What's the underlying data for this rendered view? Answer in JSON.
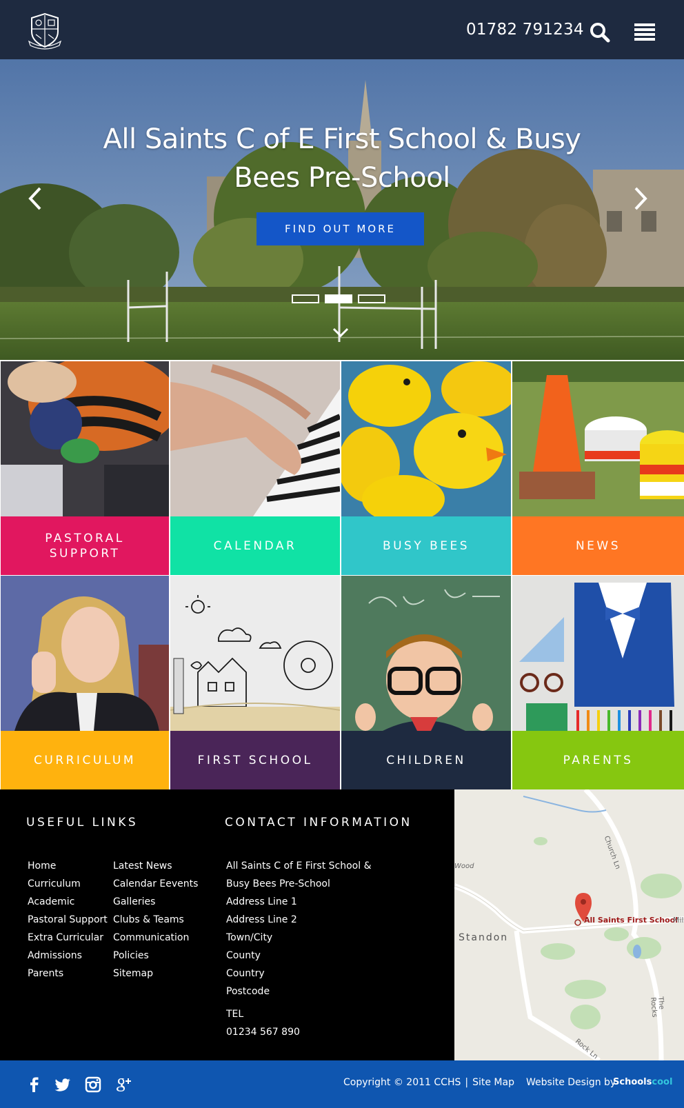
{
  "header": {
    "phone": "01782 791234",
    "logo_icon": "school-crest-icon",
    "search_icon": "search-icon",
    "menu_icon": "hamburger-menu-icon"
  },
  "hero": {
    "title": "All Saints C of E First School & Busy Bees Pre-School",
    "cta_label": "FIND OUT MORE",
    "slides_total": 3,
    "active_slide": 2,
    "prev_icon": "chevron-left-icon",
    "next_icon": "chevron-right-icon",
    "scroll_icon": "chevron-down-icon"
  },
  "tiles": [
    {
      "label": "PASTORAL SUPPORT",
      "color": "#e1175f"
    },
    {
      "label": "CALENDAR",
      "color": "#10e2a5"
    },
    {
      "label": "BUSY BEES",
      "color": "#30c6c9"
    },
    {
      "label": "NEWS",
      "color": "#ff7623"
    },
    {
      "label": "CURRICULUM",
      "color": "#ffb20e"
    },
    {
      "label": "FIRST SCHOOL",
      "color": "#4a2558"
    },
    {
      "label": "CHILDREN",
      "color": "#1e2a40"
    },
    {
      "label": "PARENTS",
      "color": "#86c710"
    }
  ],
  "footer": {
    "useful_links_title": "USEFUL LINKS",
    "links_col1": [
      "Home",
      "Curriculum",
      "Academic",
      "Pastoral Support",
      "Extra Curricular",
      "Admissions",
      "Parents"
    ],
    "links_col2": [
      "Latest News",
      "Calendar Eevents",
      "Galleries",
      "Clubs & Teams",
      "Communication",
      "Policies",
      "Sitemap"
    ],
    "contact_title": "CONTACT INFORMATION",
    "address": [
      "All Saints C of E First School &",
      "Busy Bees Pre-School",
      "Address Line 1",
      "Address Line 2",
      "Town/City",
      "County",
      "Country",
      "Postcode"
    ],
    "tel_label": "TEL",
    "tel_number": "01234 567 890",
    "map": {
      "marker_label": "All Saints First School",
      "place_label": "Standon",
      "road_labels": [
        "Church Ln",
        "The Rocks",
        "Rock Ln",
        "Wood",
        "Mil"
      ]
    }
  },
  "bottom": {
    "social_icons": [
      "facebook-icon",
      "twitter-icon",
      "instagram-icon",
      "google-plus-icon"
    ],
    "copyright": "Copyright © 2011 CCHS",
    "separator": "|",
    "sitemap_label": "Site Map",
    "credit": "Website Design by",
    "brand_main": "Schools",
    "brand_accent": "cool"
  },
  "colors": {
    "header_bg": "#1e2a40",
    "cta_bg": "#1456c8",
    "footer_bg": "#000000",
    "bottom_bg": "#0f56b0"
  }
}
